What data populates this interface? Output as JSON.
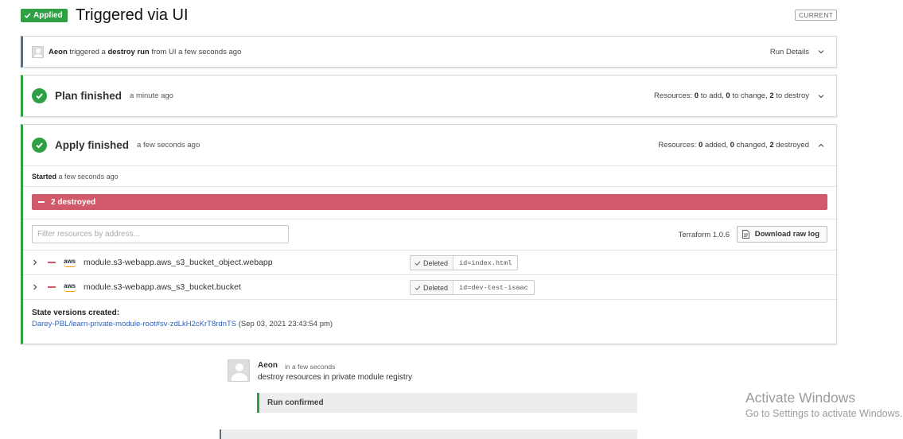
{
  "header": {
    "status_badge": "Applied",
    "title": "Triggered via UI",
    "current_badge": "CURRENT"
  },
  "trigger": {
    "user": "Aeon",
    "text_triggered": "triggered a",
    "run_type": "destroy run",
    "text_from": "from UI a few seconds ago",
    "run_details_label": "Run Details"
  },
  "plan": {
    "title": "Plan finished",
    "time": "a minute ago",
    "resources_label": "Resources:",
    "add_count": "0",
    "add_text": "to add,",
    "change_count": "0",
    "change_text": "to change,",
    "destroy_count": "2",
    "destroy_text": "to destroy"
  },
  "apply": {
    "title": "Apply finished",
    "time": "a few seconds ago",
    "resources_label": "Resources:",
    "added_count": "0",
    "added_text": "added,",
    "changed_count": "0",
    "changed_text": "changed,",
    "destroyed_count": "2",
    "destroyed_text": "destroyed",
    "started_label": "Started",
    "started_time": "a few seconds ago",
    "destroyed_bar_label": "2 destroyed",
    "filter_placeholder": "Filter resources by address...",
    "terraform_version": "Terraform 1.0.6",
    "download_label": "Download raw log",
    "resources": [
      {
        "provider": "aws",
        "address": "module.s3-webapp.aws_s3_bucket_object.webapp",
        "status": "Deleted",
        "id": "id=index.html"
      },
      {
        "provider": "aws",
        "address": "module.s3-webapp.aws_s3_bucket.bucket",
        "status": "Deleted",
        "id": "id=dev-test-isaac"
      }
    ],
    "state_title": "State versions created:",
    "state_link": "Darey-PBL/learn-private-module-root#sv-zdLkH2cKrT8rdnTS",
    "state_date": "(Sep 03, 2021 23:43:54 pm)"
  },
  "comment": {
    "author": "Aeon",
    "time": "in a few seconds",
    "body": "destroy resources in private module registry",
    "confirmed": "Run confirmed"
  },
  "watermark": {
    "title": "Activate Windows",
    "subtitle": "Go to Settings to activate Windows."
  },
  "colors": {
    "success": "#2ea043",
    "destroy": "#d05a6a",
    "link": "#2962c3"
  }
}
